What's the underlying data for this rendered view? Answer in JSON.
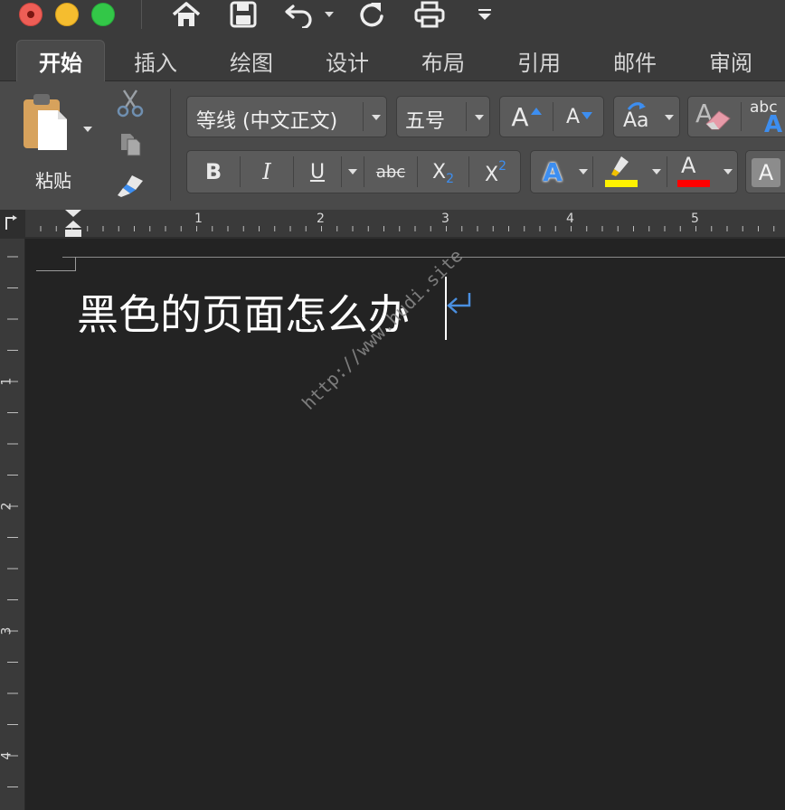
{
  "quick_access": {
    "icons": [
      "home-icon",
      "save-icon",
      "undo-icon",
      "redo-icon",
      "print-icon",
      "customize-icon"
    ]
  },
  "tabs": [
    {
      "label": "开始",
      "active": true
    },
    {
      "label": "插入",
      "active": false
    },
    {
      "label": "绘图",
      "active": false
    },
    {
      "label": "设计",
      "active": false
    },
    {
      "label": "布局",
      "active": false
    },
    {
      "label": "引用",
      "active": false
    },
    {
      "label": "邮件",
      "active": false
    },
    {
      "label": "审阅",
      "active": false
    }
  ],
  "clipboard": {
    "paste_label": "粘贴"
  },
  "font": {
    "name": "等线 (中文正文)",
    "size": "五号",
    "grow_label": "A",
    "shrink_label": "A",
    "change_case_label": "Aa",
    "clear_format_label": "A",
    "text_effect_label": "abc"
  },
  "format_buttons": {
    "bold": "B",
    "italic": "I",
    "underline": "U",
    "strikethrough": "abc",
    "subscript": "X",
    "subscript_mark": "2",
    "superscript": "X",
    "superscript_mark": "2",
    "effect": "A",
    "font_color": "A",
    "shading": "A"
  },
  "colors": {
    "highlight": "#fff200",
    "font_color": "#ff0000",
    "accent_blue": "#3d8ef0"
  },
  "ruler": {
    "h_numbers": [
      "1",
      "2",
      "3",
      "4",
      "5"
    ],
    "v_numbers": [
      "1",
      "2",
      "3",
      "4"
    ]
  },
  "document": {
    "text": "黑色的页面怎么办",
    "watermark": "http://www.hudi.site"
  }
}
